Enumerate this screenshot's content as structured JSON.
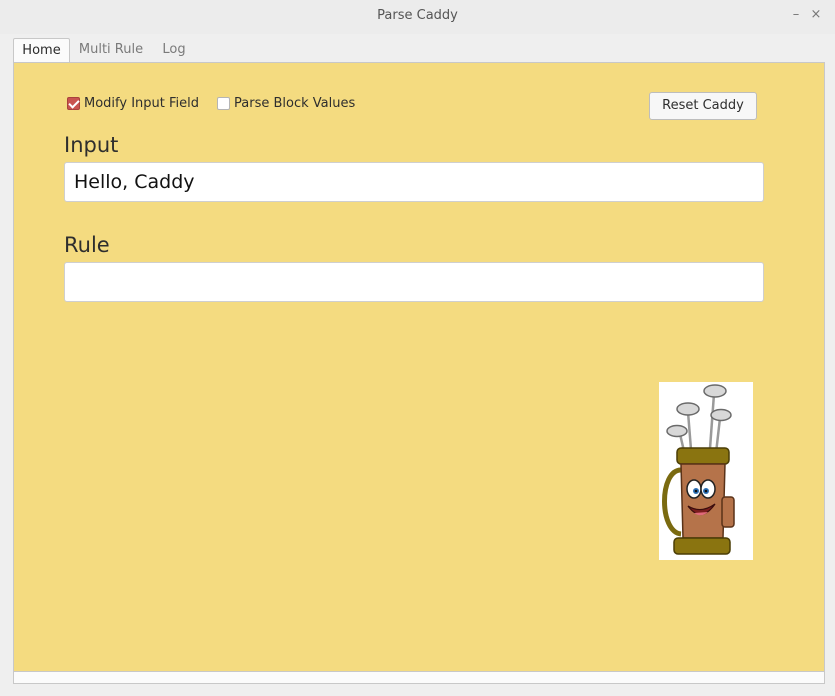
{
  "window": {
    "title": "Parse Caddy",
    "minimize": "–",
    "close": "×"
  },
  "tabs": [
    {
      "label": "Home",
      "active": true
    },
    {
      "label": "Multi Rule",
      "active": false
    },
    {
      "label": "Log",
      "active": false
    }
  ],
  "options": {
    "modify_input_label": "Modify Input Field",
    "modify_input_checked": true,
    "parse_block_label": "Parse Block Values",
    "parse_block_checked": false
  },
  "reset_label": "Reset Caddy",
  "input": {
    "heading": "Input",
    "value": "Hello, Caddy"
  },
  "rule": {
    "heading": "Rule",
    "value": ""
  },
  "colors": {
    "panel_bg": "#f4db80",
    "checkbox_accent": "#c9544f"
  }
}
